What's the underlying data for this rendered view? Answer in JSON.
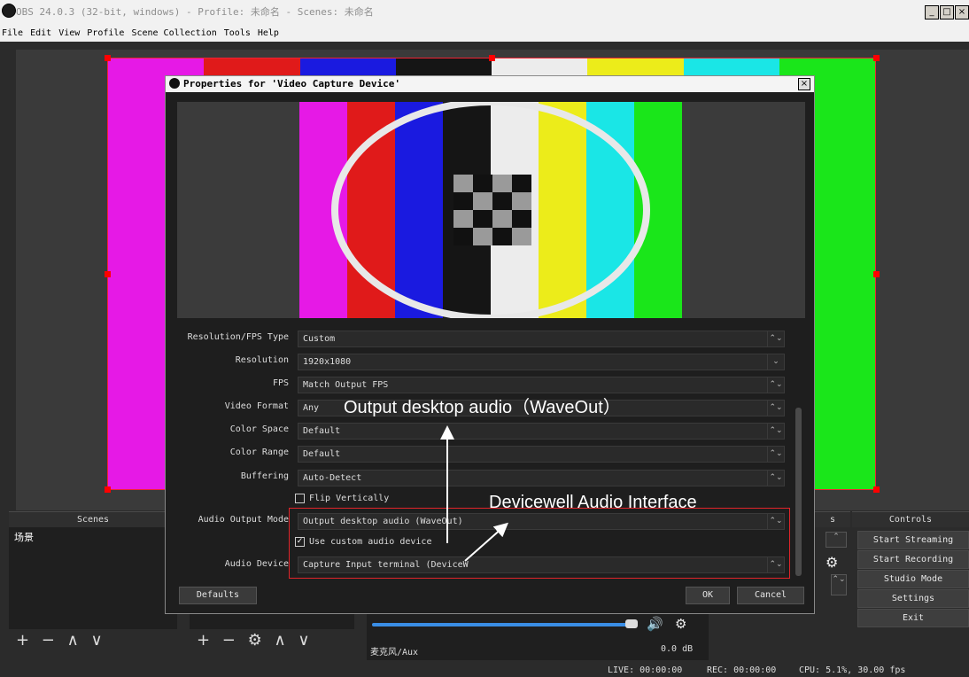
{
  "window": {
    "title": "OBS 24.0.3 (32-bit, windows) - Profile: 未命名 - Scenes: 未命名",
    "controls": [
      "_",
      "□",
      "×"
    ]
  },
  "menu": [
    "File",
    "Edit",
    "View",
    "Profile",
    "Scene Collection",
    "Tools",
    "Help"
  ],
  "colors": {
    "bars": [
      "#e619e6",
      "#e01a1a",
      "#1a1ae0",
      "#151515",
      "#ececec",
      "#ecec1a",
      "#1ae6e6",
      "#1ae61a"
    ],
    "annotation_box": "#e0242a"
  },
  "dialog": {
    "title": "Properties for 'Video Capture Device'",
    "close": "×",
    "fields": [
      {
        "label": "Resolution/FPS Type",
        "value": "Custom",
        "arrow": "⌃⌄"
      },
      {
        "label": "Resolution",
        "value": "1920x1080",
        "arrow": "⌄"
      },
      {
        "label": "FPS",
        "value": "Match Output FPS",
        "arrow": "⌃⌄"
      },
      {
        "label": "Video Format",
        "value": "Any",
        "arrow": "⌃⌄"
      },
      {
        "label": "Color Space",
        "value": "Default",
        "arrow": "⌃⌄"
      },
      {
        "label": "Color Range",
        "value": "Default",
        "arrow": "⌃⌄"
      },
      {
        "label": "Buffering",
        "value": "Auto-Detect",
        "arrow": "⌃⌄"
      }
    ],
    "flip_vertically": {
      "label": "Flip Vertically",
      "checked": false
    },
    "audio_output_mode": {
      "label": "Audio Output Mode",
      "value": "Output desktop audio (WaveOut)",
      "arrow": "⌃⌄"
    },
    "use_custom_audio": {
      "label": "Use custom audio device",
      "checked": true,
      "mark": "✓"
    },
    "audio_device": {
      "label": "Audio Device",
      "value": "Capture Input terminal (DeviceW",
      "arrow": "⌃⌄"
    },
    "defaults_button": "Defaults",
    "ok_button": "OK",
    "cancel_button": "Cancel"
  },
  "annotations": {
    "top": "Output desktop audio（WaveOut）",
    "bottom": "Devicewell Audio Interface"
  },
  "docks": {
    "scenes": {
      "title": "Scenes",
      "items": [
        "场景"
      ]
    },
    "sources_fragment": "s",
    "controls": {
      "title": "Controls",
      "buttons": [
        "Start Streaming",
        "Start Recording",
        "Studio Mode",
        "Settings",
        "Exit"
      ]
    },
    "mixer": {
      "channel": "麦克风/Aux",
      "level": "0.0 dB"
    },
    "toolbar_scenes": "+ − ∧ ∨",
    "toolbar_sources": "+ − ⚙ ∧ ∨"
  },
  "status": {
    "live": "LIVE: 00:00:00",
    "rec": "REC: 00:00:00",
    "cpu": "CPU: 5.1%, 30.00 fps"
  }
}
